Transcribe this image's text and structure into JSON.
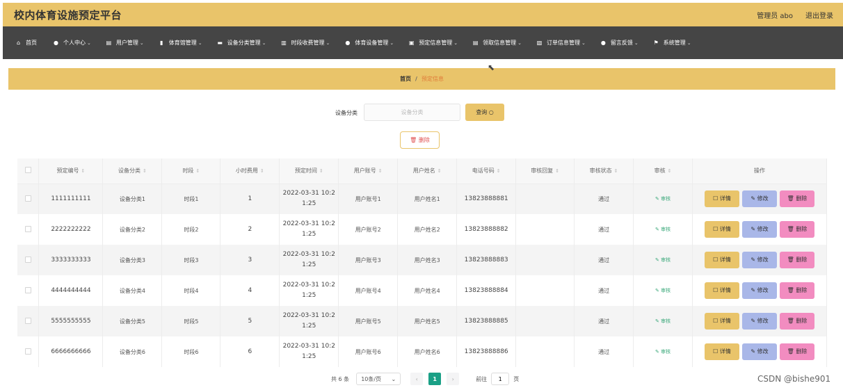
{
  "header": {
    "title": "校内体育设施预定平台",
    "admin": "管理员 abo",
    "logout": "退出登录"
  },
  "nav": [
    {
      "label": "首页",
      "icon": "home-icon",
      "glyph": "⌂",
      "chevron": ""
    },
    {
      "label": "个人中心",
      "icon": "user-icon",
      "glyph": "●",
      "chevron": "⌄"
    },
    {
      "label": "用户管理",
      "icon": "users-icon",
      "glyph": "▤",
      "chevron": "⌄"
    },
    {
      "label": "体育馆管理",
      "icon": "chat-icon",
      "glyph": "▮",
      "chevron": "⌄"
    },
    {
      "label": "设备分类管理",
      "icon": "category-icon",
      "glyph": "▬",
      "chevron": "⌄"
    },
    {
      "label": "时段收费管理",
      "icon": "bar-chart-icon",
      "glyph": "▥",
      "chevron": "⌄"
    },
    {
      "label": "体育设备管理",
      "icon": "person-icon",
      "glyph": "●",
      "chevron": "⌄"
    },
    {
      "label": "预定信息管理",
      "icon": "print-icon",
      "glyph": "▣",
      "chevron": "⌄"
    },
    {
      "label": "领取信息管理",
      "icon": "clipboard-icon",
      "glyph": "▤",
      "chevron": "⌄"
    },
    {
      "label": "订单信息管理",
      "icon": "document-icon",
      "glyph": "▧",
      "chevron": "⌄"
    },
    {
      "label": "留言反馈",
      "icon": "feedback-icon",
      "glyph": "●",
      "chevron": "⌄"
    },
    {
      "label": "系统管理",
      "icon": "flag-icon",
      "glyph": "⚑",
      "chevron": "⌄"
    }
  ],
  "breadcrumb": {
    "home": "首页",
    "sep": "/",
    "current": "预定信息"
  },
  "search": {
    "label": "设备分类",
    "placeholder": "设备分类",
    "button": "查询 ○"
  },
  "toolbar": {
    "delete": "🗑 删除"
  },
  "table": {
    "headers": [
      "预定编号",
      "设备分类",
      "时段",
      "小时费用",
      "预定时间",
      "用户账号",
      "用户姓名",
      "电话号码",
      "审核回复",
      "审核状态",
      "审核",
      "操作"
    ],
    "audit_link": "✎ 审核",
    "ops": {
      "detail": "☐ 详情",
      "edit": "✎ 修改",
      "delete": "🗑 删除"
    },
    "rows": [
      {
        "id": "1111111111",
        "category": "设备分类1",
        "slot": "时段1",
        "fee": "1",
        "time1": "2022-03-31 10:2",
        "time2": "1:25",
        "account": "用户账号1",
        "name": "用户姓名1",
        "phone": "13823888881",
        "reply": "",
        "status": "通过"
      },
      {
        "id": "2222222222",
        "category": "设备分类2",
        "slot": "时段2",
        "fee": "2",
        "time1": "2022-03-31 10:2",
        "time2": "1:25",
        "account": "用户账号2",
        "name": "用户姓名2",
        "phone": "13823888882",
        "reply": "",
        "status": "通过"
      },
      {
        "id": "3333333333",
        "category": "设备分类3",
        "slot": "时段3",
        "fee": "3",
        "time1": "2022-03-31 10:2",
        "time2": "1:25",
        "account": "用户账号3",
        "name": "用户姓名3",
        "phone": "13823888883",
        "reply": "",
        "status": "通过"
      },
      {
        "id": "4444444444",
        "category": "设备分类4",
        "slot": "时段4",
        "fee": "4",
        "time1": "2022-03-31 10:2",
        "time2": "1:25",
        "account": "用户账号4",
        "name": "用户姓名4",
        "phone": "13823888884",
        "reply": "",
        "status": "通过"
      },
      {
        "id": "5555555555",
        "category": "设备分类5",
        "slot": "时段5",
        "fee": "5",
        "time1": "2022-03-31 10:2",
        "time2": "1:25",
        "account": "用户账号5",
        "name": "用户姓名5",
        "phone": "13823888885",
        "reply": "",
        "status": "通过"
      },
      {
        "id": "6666666666",
        "category": "设备分类6",
        "slot": "时段6",
        "fee": "6",
        "time1": "2022-03-31 10:2",
        "time2": "1:25",
        "account": "用户账号6",
        "name": "用户姓名6",
        "phone": "13823888886",
        "reply": "",
        "status": "通过"
      }
    ]
  },
  "pagination": {
    "total": "共 6 条",
    "page_size": "10条/页",
    "prev": "‹",
    "current_page": "1",
    "next": "›",
    "goto": "前往",
    "goto_value": "1",
    "page_suffix": "页"
  },
  "watermark": "CSDN @bishe901",
  "colors": {
    "accent": "#e9c46a",
    "nav_bg": "#454545",
    "page_active": "#1aa086",
    "edit": "#a9b7e8",
    "delete": "#f28cc0"
  }
}
